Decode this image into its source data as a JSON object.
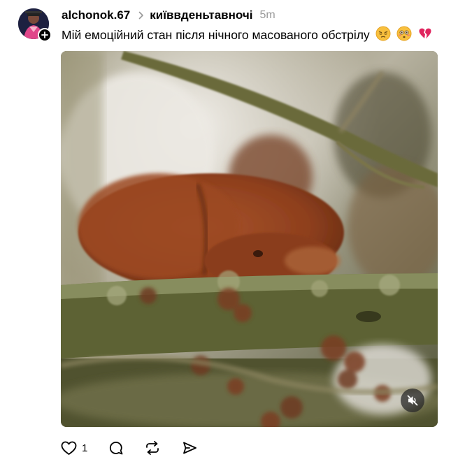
{
  "post": {
    "username": "alchonok.67",
    "topic": "київвденьтавночі",
    "time": "5m",
    "caption": "Мій емоційний стан після нічного масованого обстрілу",
    "emojis": [
      "pensive-face-emoji",
      "flushed-face-emoji",
      "broken-heart-emoji"
    ]
  },
  "media": {
    "type": "video",
    "muted": true
  },
  "actions": {
    "like_count": "1"
  },
  "colors": {
    "text": "#000000",
    "muted": "#999999",
    "accent_red": "#e0245e"
  }
}
